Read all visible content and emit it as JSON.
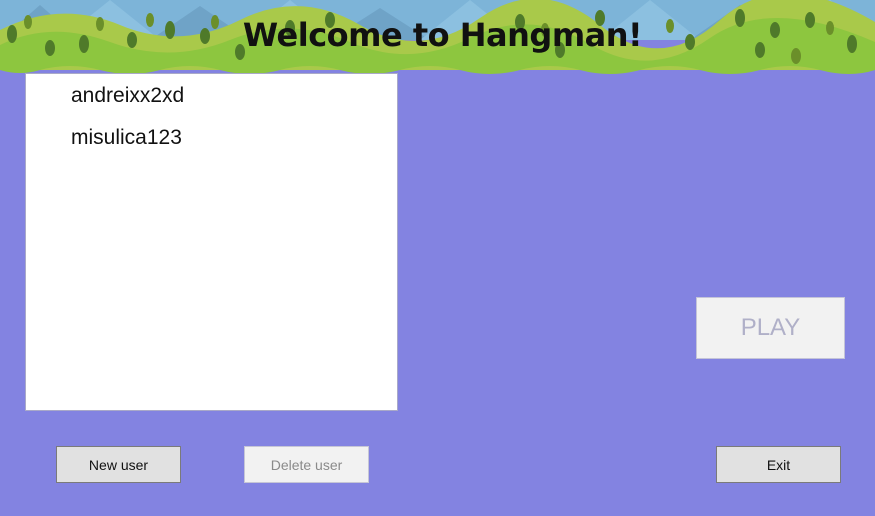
{
  "window": {
    "title": "Welcome to Hangman!"
  },
  "users": {
    "items": [
      "andreixx2xd",
      "misulica123"
    ]
  },
  "buttons": {
    "play": "PLAY",
    "new_user": "New user",
    "delete_user": "Delete user",
    "exit": "Exit"
  },
  "colors": {
    "background": "#8383e1",
    "sky": "#7db4d8",
    "hills": "#8dc63f"
  }
}
